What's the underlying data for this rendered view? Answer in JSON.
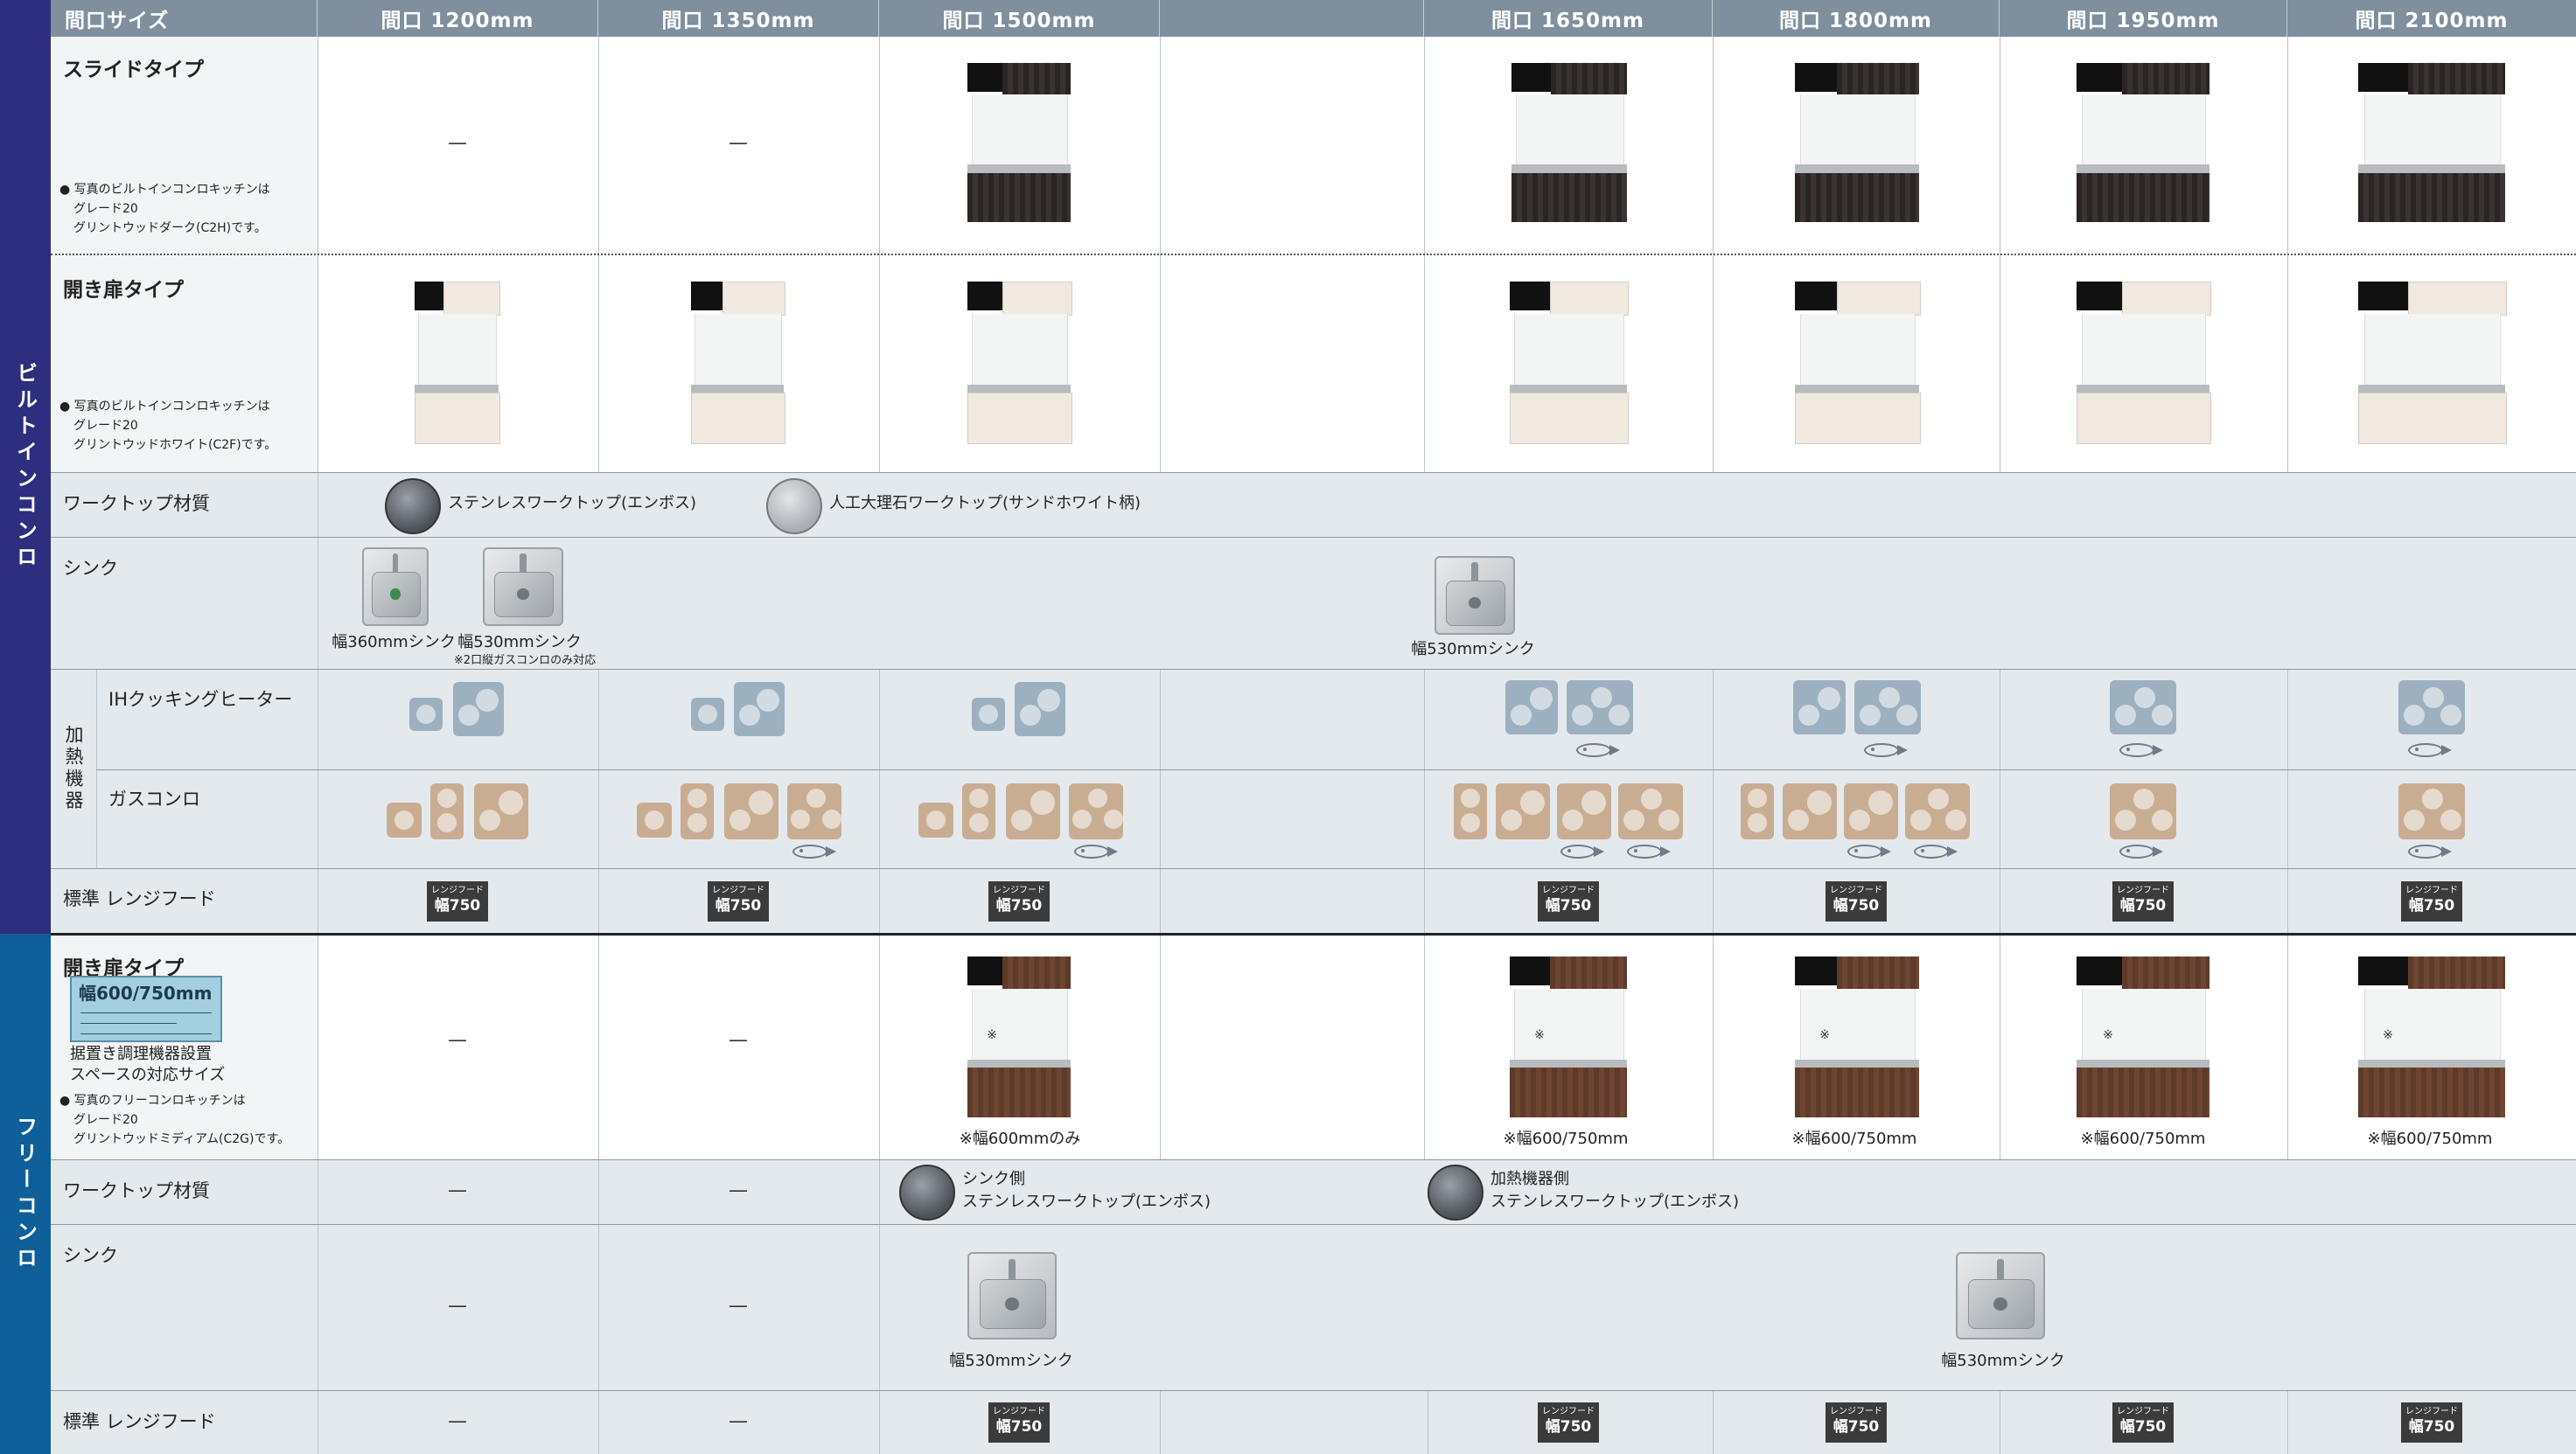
{
  "header": {
    "first": "間口サイズ",
    "sizes": [
      "間口 1200mm",
      "間口 1350mm",
      "間口 1500mm",
      "間口 1650mm",
      "間口 1800mm",
      "間口 1950mm",
      "間口 2100mm"
    ]
  },
  "side": {
    "builtin": "ビルトインコンロ",
    "free": "フリーコンロ"
  },
  "builtin": {
    "slide": {
      "label": "スライドタイプ",
      "note": [
        "● 写真のビルトインコンロキッチンは",
        "グレード20",
        "グリントウッドダーク(C2H)です。"
      ]
    },
    "hinged": {
      "label": "開き扉タイプ",
      "note": [
        "● 写真のビルトインコンロキッチンは",
        "グレード20",
        "グリントウッドホワイト(C2F)です。"
      ]
    },
    "worktop": {
      "label": "ワークトップ材質",
      "m1": "ステンレスワークトップ(エンボス)",
      "m2": "人工大理石ワークトップ(サンドホワイト柄)"
    },
    "sink": {
      "label": "シンク",
      "c1": "幅360mmシンク",
      "c2": "幅530mmシンク",
      "c2note": "※2口縦ガスコンロのみ対応",
      "c3": "幅530mmシンク"
    },
    "heater_group": "加熱機器",
    "ih": "IHクッキングヒーター",
    "gas": "ガスコンロ",
    "hood": {
      "label": "標準 レンジフード"
    }
  },
  "badge": {
    "line1": "レンジフード",
    "line2": "幅750"
  },
  "dash": "—",
  "free": {
    "hinged": {
      "label": "開き扉タイプ",
      "badge": "幅600/750mm",
      "badge_sub": "据置き調理機器設置",
      "badge_sub2": "スペースの対応サイズ",
      "note": [
        "● 写真のフリーコンロキッチンは",
        "グレード20",
        "グリントウッドミディアム(C2G)です。"
      ],
      "dim_mark": "※"
    },
    "captions": {
      "c1500": "※幅600mmのみ",
      "c1650": "※幅600/750mm",
      "c1800": "※幅600/750mm",
      "c1950": "※幅600/750mm",
      "c2100": "※幅600/750mm"
    },
    "worktop": {
      "label": "ワークトップ材質",
      "m1a": "シンク側",
      "m1b": "ステンレスワークトップ(エンボス)",
      "m2a": "加熱機器側",
      "m2b": "ステンレスワークトップ(エンボス)"
    },
    "sink": {
      "label": "シンク",
      "c1": "幅530mmシンク",
      "c2": "幅530mmシンク"
    },
    "hood": {
      "label": "標準 レンジフード"
    }
  }
}
